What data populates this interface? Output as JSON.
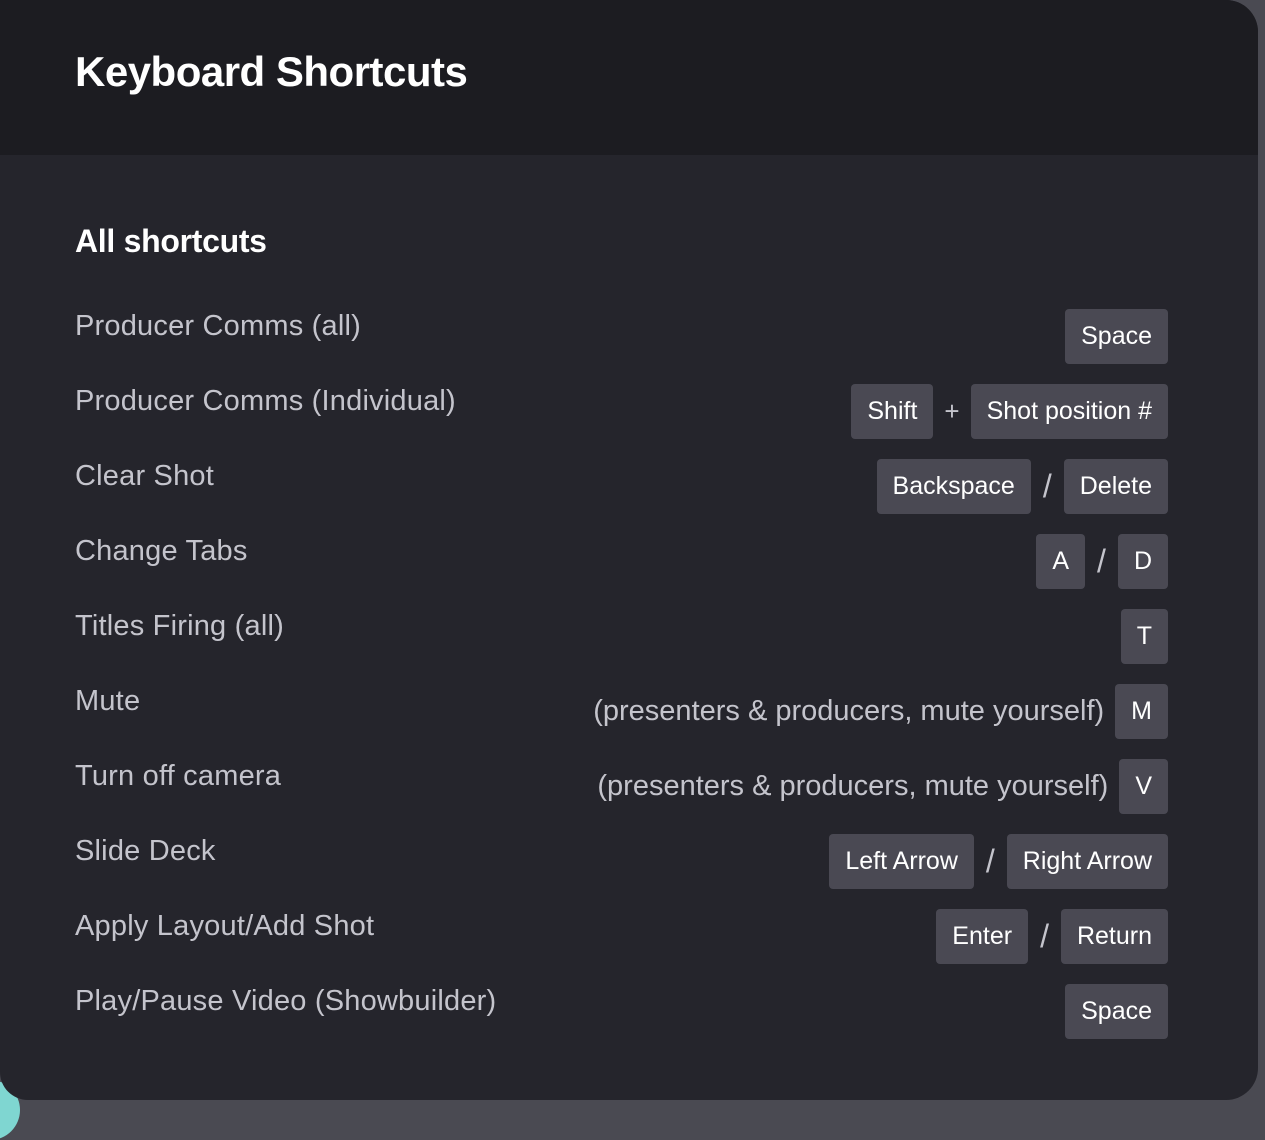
{
  "dialog": {
    "title": "Keyboard Shortcuts",
    "section_title": "All shortcuts"
  },
  "shortcuts": [
    {
      "label": "Producer Comms (all)",
      "keys": [
        "Space"
      ],
      "separators": []
    },
    {
      "label": "Producer Comms (Individual)",
      "keys": [
        "Shift",
        "Shot position #"
      ],
      "separators": [
        "+"
      ]
    },
    {
      "label": "Clear Shot",
      "keys": [
        "Backspace",
        "Delete"
      ],
      "separators": [
        "/"
      ]
    },
    {
      "label": "Change Tabs",
      "keys": [
        "A",
        "D"
      ],
      "separators": [
        "/"
      ]
    },
    {
      "label": "Titles Firing (all)",
      "keys": [
        "T"
      ],
      "separators": []
    },
    {
      "label": "Mute",
      "note": "(presenters & producers, mute yourself)",
      "keys": [
        "M"
      ],
      "separators": []
    },
    {
      "label": "Turn off camera",
      "note": "(presenters & producers, mute yourself)",
      "keys": [
        "V"
      ],
      "separators": []
    },
    {
      "label": "Slide Deck",
      "keys": [
        "Left Arrow",
        "Right Arrow"
      ],
      "separators": [
        "/"
      ]
    },
    {
      "label": "Apply Layout/Add Shot",
      "keys": [
        "Enter",
        "Return"
      ],
      "separators": [
        "/"
      ]
    },
    {
      "label": "Play/Pause Video (Showbuilder)",
      "keys": [
        "Space"
      ],
      "separators": []
    }
  ]
}
